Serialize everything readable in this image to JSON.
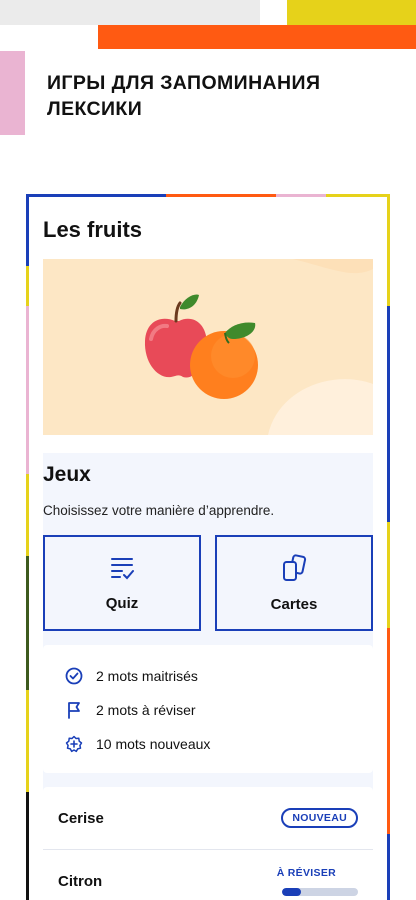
{
  "header": {
    "title": "ИГРЫ ДЛЯ ЗАПОМИНАНИЯ ЛЕКСИКИ"
  },
  "card": {
    "title": "Les fruits",
    "games": {
      "title": "Jeux",
      "subtitle": "Choisissez votre manière d’apprendre.",
      "buttons": [
        {
          "label": "Quiz",
          "icon": "checklist-icon"
        },
        {
          "label": "Cartes",
          "icon": "cards-icon"
        }
      ]
    },
    "stats": [
      {
        "text": "2 mots maitrisés",
        "icon": "check-circle-icon"
      },
      {
        "text": "2 mots à réviser",
        "icon": "flag-icon"
      },
      {
        "text": "10 mots nouveaux",
        "icon": "plus-badge-icon"
      }
    ],
    "words": [
      {
        "name": "Cerise",
        "badge": "NOUVEAU"
      },
      {
        "name": "Citron",
        "status": "À RÉVISER",
        "progress": 0.25
      }
    ]
  },
  "colors": {
    "accent": "#1a3fb8",
    "orange": "#ff5a12",
    "yellow": "#e6d21a",
    "pink": "#eab4d2",
    "hero_bg": "#fde7c5"
  }
}
